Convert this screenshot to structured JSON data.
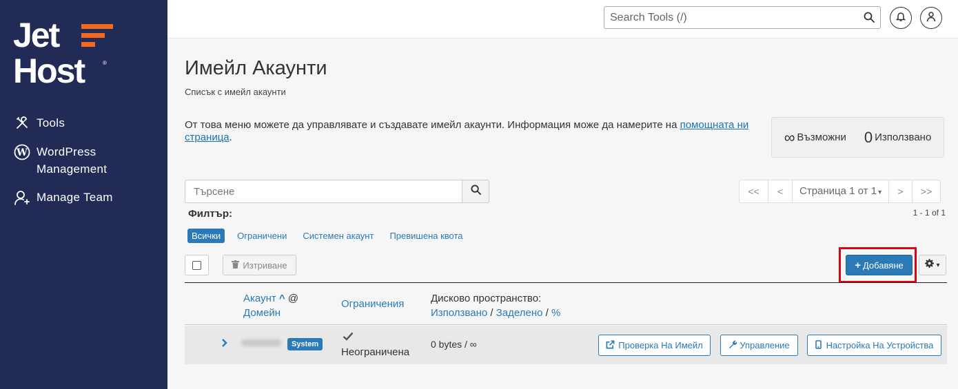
{
  "brand": {
    "line1": "Jet",
    "line2": "Host",
    "reg": "®",
    "accent": "#f26a21",
    "sidebar_bg": "#212b56"
  },
  "sidebar": {
    "items": [
      {
        "label": "Tools",
        "icon": "tools-icon"
      },
      {
        "label": "WordPress Management",
        "label_line1": "WordPress",
        "label_line2": "Management",
        "icon": "wordpress-icon"
      },
      {
        "label": "Manage Team",
        "icon": "add-user-icon"
      }
    ]
  },
  "topbar": {
    "search_placeholder": "Search Tools (/)",
    "notifications_icon": "bell-icon",
    "profile_icon": "user-icon"
  },
  "page": {
    "title": "Имейл Акаунти",
    "subtitle": "Списък с имейл акаунти",
    "description": "От това меню можете да управлявате и създавате имейл акаунти. Информация може да намерите на ",
    "help_link": "помощната ни страница",
    "description_end": "."
  },
  "stats": {
    "available_value": "∞",
    "available_label": "Възможни",
    "used_value": "0",
    "used_label": "Използвано"
  },
  "search": {
    "placeholder": "Търсене"
  },
  "pagination": {
    "first": "<<",
    "prev": "<",
    "page_label": "Страница 1 от 1",
    "next": ">",
    "last": ">>",
    "count": "1 - 1 of 1"
  },
  "filter": {
    "label": "Филтър:",
    "options": [
      "Всички",
      "Ограничени",
      "Системен акаунт",
      "Превишена квота"
    ],
    "active": "Всички"
  },
  "toolbar": {
    "delete_label": "Изтриване",
    "add_label": "Добавяне"
  },
  "table": {
    "col_account": "Акаунт",
    "col_at": "@",
    "col_domain": "Домейн",
    "col_restrictions": "Ограничения",
    "col_disk": "Дисково пространство:",
    "col_disk_used": "Използвано",
    "col_disk_alloc": "Заделено",
    "col_disk_pct": "%",
    "sep": "/",
    "rows": [
      {
        "badge": "System",
        "restriction": "Неограничена",
        "disk": "0 bytes / ∞",
        "actions": [
          "Проверка На Имейл",
          "Управление",
          "Настройка На Устройства"
        ]
      }
    ]
  }
}
